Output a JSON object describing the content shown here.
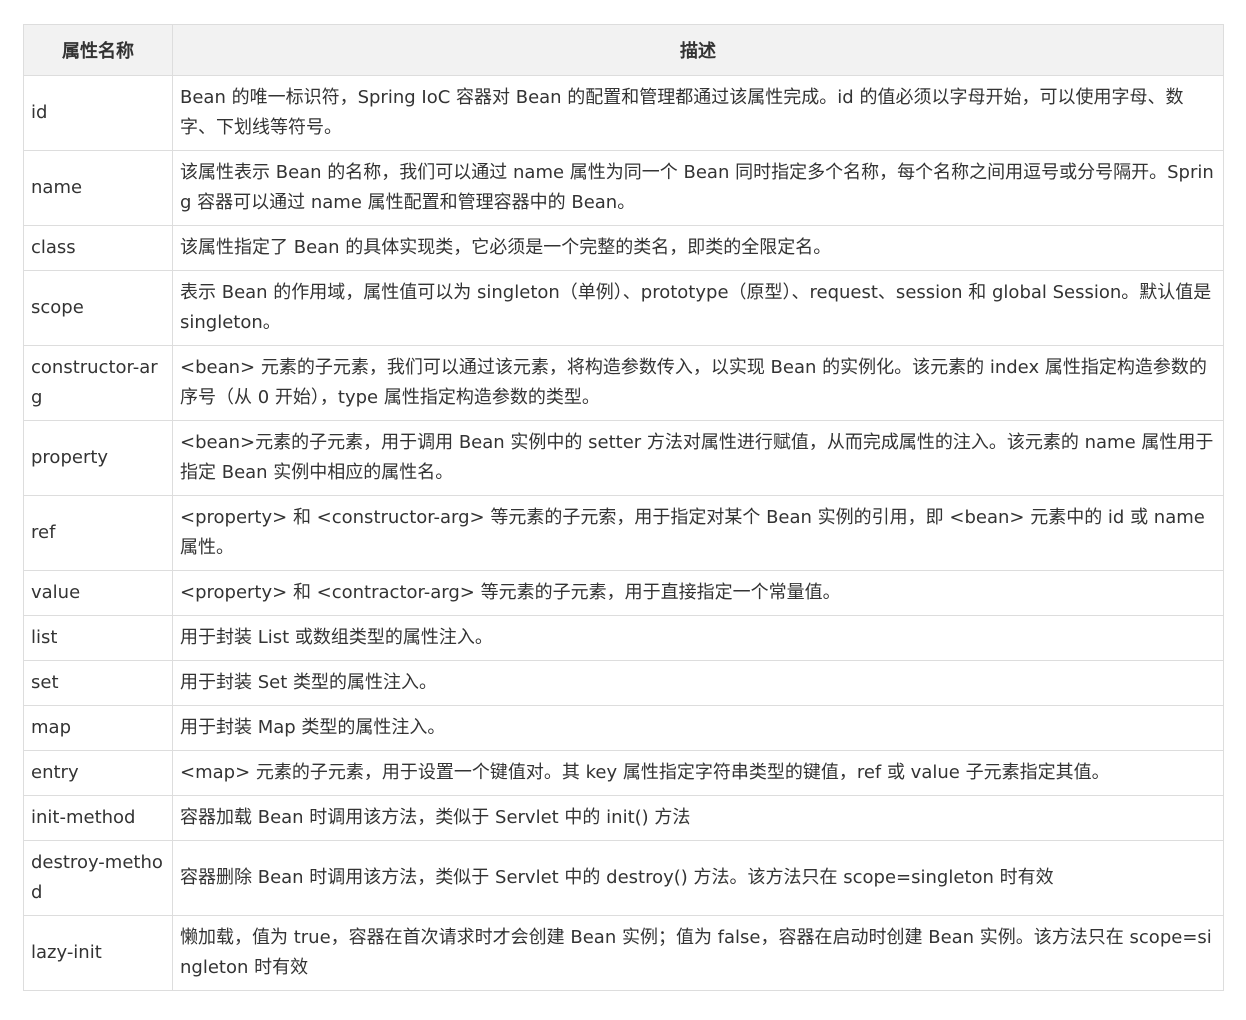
{
  "table": {
    "headers": [
      "属性名称",
      "描述"
    ],
    "rows": [
      {
        "name": "id",
        "desc": "Bean 的唯一标识符，Spring IoC 容器对 Bean 的配置和管理都通过该属性完成。id 的值必须以字母开始，可以使用字母、数字、下划线等符号。"
      },
      {
        "name": "name",
        "desc": "该属性表示 Bean 的名称，我们可以通过 name 属性为同一个 Bean 同时指定多个名称，每个名称之间用逗号或分号隔开。Spring 容器可以通过 name 属性配置和管理容器中的 Bean。"
      },
      {
        "name": "class",
        "desc": "该属性指定了 Bean 的具体实现类，它必须是一个完整的类名，即类的全限定名。"
      },
      {
        "name": "scope",
        "desc": "表示 Bean 的作用域，属性值可以为 singleton（单例）、prototype（原型）、request、session 和 global Session。默认值是 singleton。"
      },
      {
        "name": "constructor-arg",
        "desc": "<bean> 元素的子元素，我们可以通过该元素，将构造参数传入，以实现 Bean 的实例化。该元素的 index 属性指定构造参数的序号（从 0 开始），type 属性指定构造参数的类型。"
      },
      {
        "name": "property",
        "desc": "<bean>元素的子元素，用于调用 Bean 实例中的 setter 方法对属性进行赋值，从而完成属性的注入。该元素的 name 属性用于指定 Bean 实例中相应的属性名。"
      },
      {
        "name": "ref",
        "desc": "<property> 和 <constructor-arg> 等元素的子元索，用于指定对某个 Bean 实例的引用，即 <bean> 元素中的 id 或 name 属性。"
      },
      {
        "name": "value",
        "desc": "<property> 和 <contractor-arg> 等元素的子元素，用于直接指定一个常量值。"
      },
      {
        "name": "list",
        "desc": "用于封装 List 或数组类型的属性注入。"
      },
      {
        "name": "set",
        "desc": "用于封装 Set 类型的属性注入。"
      },
      {
        "name": "map",
        "desc": "用于封装 Map 类型的属性注入。"
      },
      {
        "name": "entry",
        "desc": " <map> 元素的子元素，用于设置一个键值对。其 key 属性指定字符串类型的键值，ref 或 value 子元素指定其值。"
      },
      {
        "name": "init-method",
        "desc": "容器加载 Bean 时调用该方法，类似于 Servlet 中的 init() 方法"
      },
      {
        "name": "destroy-method",
        "desc": "容器删除 Bean 时调用该方法，类似于 Servlet 中的 destroy() 方法。该方法只在 scope=singleton 时有效"
      },
      {
        "name": "lazy-init",
        "desc": "懒加载，值为 true，容器在首次请求时才会创建 Bean 实例；值为 false，容器在启动时创建 Bean 实例。该方法只在 scope=singleton 时有效"
      }
    ]
  }
}
